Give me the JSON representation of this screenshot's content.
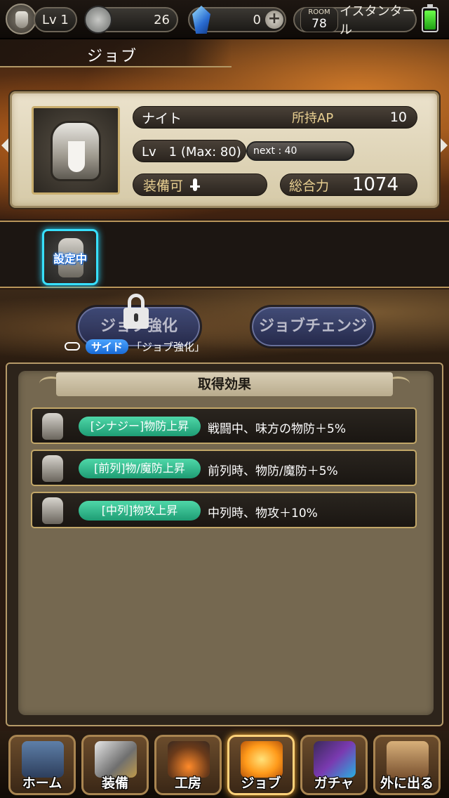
{
  "status_bar": {
    "level": "Lv 1",
    "coins": "26",
    "gems": "0",
    "room_label": "ROOM",
    "room_number": "78",
    "location": "イスタンタール"
  },
  "page": {
    "title": "ジョブ"
  },
  "job_card": {
    "job_name": "ナイト",
    "ap_label": "所持AP",
    "ap_value": "10",
    "level_text": "Lv　1 (Max: 80)",
    "next_text": "next : 40",
    "equip_label": "装備可",
    "power_label": "総合力",
    "power_value": "1074"
  },
  "job_slot": {
    "label": "設定中"
  },
  "actions": {
    "enhance_label": "ジョブ強化",
    "change_label": "ジョブチェンジ",
    "side_tag": "サイド",
    "side_text": "「ジョブ強化」"
  },
  "effects": {
    "title": "取得効果",
    "items": [
      {
        "name": "[シナジー]物防上昇",
        "desc": "戦闘中、味方の物防＋5%"
      },
      {
        "name": "[前列]物/魔防上昇",
        "desc": "前列時、物防/魔防＋5%"
      },
      {
        "name": "[中列]物攻上昇",
        "desc": "中列時、物攻＋10%"
      }
    ]
  },
  "nav": {
    "items": [
      {
        "label": "ホーム",
        "icon": "home-icon"
      },
      {
        "label": "装備",
        "icon": "equipment-icon"
      },
      {
        "label": "工房",
        "icon": "workshop-icon"
      },
      {
        "label": "ジョブ",
        "icon": "job-icon"
      },
      {
        "label": "ガチャ",
        "icon": "gacha-icon"
      },
      {
        "label": "外に出る",
        "icon": "exit-door-icon"
      }
    ]
  },
  "colors": {
    "accent_gold": "#c2a768",
    "effect_chip": "#2fbf8c",
    "slot_glow": "#38e0ff",
    "button_blue": "#2e3c70"
  }
}
